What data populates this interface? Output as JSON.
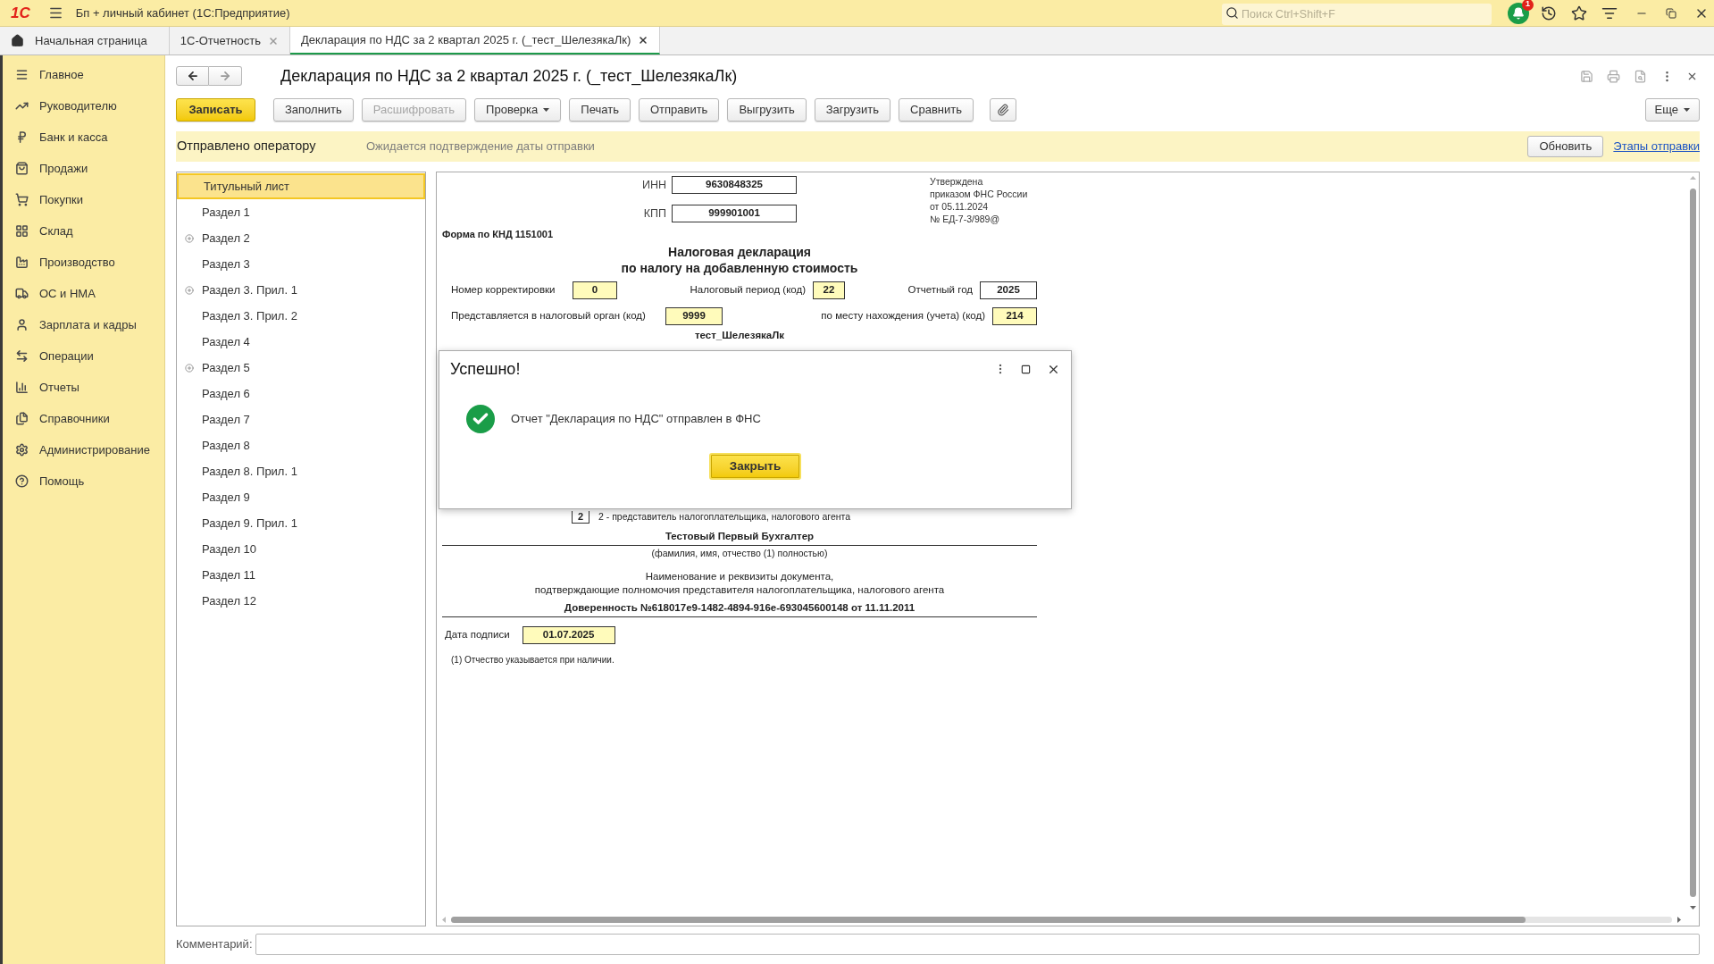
{
  "app": {
    "logo": "1С",
    "title": "Бп + личный кабинет  (1С:Предприятие)",
    "search": {
      "placeholder": "Поиск Ctrl+Shift+F"
    },
    "notifications": "1"
  },
  "tabs": [
    {
      "label": "Начальная страница",
      "kind": "home",
      "selected": false
    },
    {
      "label": "1С-Отчетность",
      "kind": "closable",
      "selected": false
    },
    {
      "label": "Декларация по НДС за 2 квартал 2025 г. (_тест_ШелезякаЛк)",
      "kind": "closable",
      "selected": true
    }
  ],
  "sidebar": {
    "items": [
      {
        "label": "Главное"
      },
      {
        "label": "Руководителю"
      },
      {
        "label": "Банк и касса"
      },
      {
        "label": "Продажи"
      },
      {
        "label": "Покупки"
      },
      {
        "label": "Склад"
      },
      {
        "label": "Производство"
      },
      {
        "label": "ОС и НМА"
      },
      {
        "label": "Зарплата и кадры"
      },
      {
        "label": "Операции"
      },
      {
        "label": "Отчеты"
      },
      {
        "label": "Справочники"
      },
      {
        "label": "Администрирование"
      },
      {
        "label": "Помощь"
      }
    ]
  },
  "form": {
    "title": "Декларация по НДС за 2 квартал 2025 г. (_тест_ШелезякаЛк)",
    "toolbar": [
      {
        "label": "Записать",
        "kind": "primary",
        "disabled": false
      },
      {
        "label": "Заполнить",
        "kind": "plain",
        "disabled": false
      },
      {
        "label": "Расшифровать",
        "kind": "plain",
        "disabled": true
      },
      {
        "label": "Проверка",
        "kind": "dropdown",
        "disabled": false
      },
      {
        "label": "Печать",
        "kind": "plain",
        "disabled": false
      },
      {
        "label": "Отправить",
        "kind": "plain",
        "disabled": false
      },
      {
        "label": "Выгрузить",
        "kind": "plain",
        "disabled": false
      },
      {
        "label": "Загрузить",
        "kind": "plain",
        "disabled": false
      },
      {
        "label": "Сравнить",
        "kind": "plain",
        "disabled": false
      }
    ],
    "more": "Еще",
    "status": {
      "state": "Отправлено оператору",
      "note": "Ожидается подтверждение даты отправки",
      "refresh": "Обновить",
      "link": "Этапы отправки"
    },
    "sections": [
      {
        "label": "Титульный лист",
        "expandable": false,
        "selected": true
      },
      {
        "label": "Раздел 1",
        "expandable": false,
        "selected": false
      },
      {
        "label": "Раздел 2",
        "expandable": true,
        "selected": false
      },
      {
        "label": "Раздел 3",
        "expandable": false,
        "selected": false
      },
      {
        "label": "Раздел 3. Прил. 1",
        "expandable": true,
        "selected": false
      },
      {
        "label": "Раздел 3. Прил. 2",
        "expandable": false,
        "selected": false
      },
      {
        "label": "Раздел 4",
        "expandable": false,
        "selected": false
      },
      {
        "label": "Раздел 5",
        "expandable": true,
        "selected": false
      },
      {
        "label": "Раздел 6",
        "expandable": false,
        "selected": false
      },
      {
        "label": "Раздел 7",
        "expandable": false,
        "selected": false
      },
      {
        "label": "Раздел 8",
        "expandable": false,
        "selected": false
      },
      {
        "label": "Раздел 8. Прил. 1",
        "expandable": false,
        "selected": false
      },
      {
        "label": "Раздел 9",
        "expandable": false,
        "selected": false
      },
      {
        "label": "Раздел 9. Прил. 1",
        "expandable": false,
        "selected": false
      },
      {
        "label": "Раздел 10",
        "expandable": false,
        "selected": false
      },
      {
        "label": "Раздел 11",
        "expandable": false,
        "selected": false
      },
      {
        "label": "Раздел 12",
        "expandable": false,
        "selected": false
      }
    ],
    "document": {
      "inn": {
        "label": "ИНН",
        "value": "9630848325",
        "editable": false
      },
      "kpp": {
        "label": "КПП",
        "value": "999901001",
        "editable": false
      },
      "knd": "Форма по КНД 1151001",
      "approval": [
        "Утверждена",
        "приказом ФНС России",
        "от 05.11.2024",
        "№ ЕД-7-3/989@"
      ],
      "heading": [
        "Налоговая декларация",
        "по налогу на добавленную стоимость"
      ],
      "row1": [
        {
          "label": "Номер корректировки",
          "value": "0",
          "editable": true
        },
        {
          "label": "Налоговый период (код)",
          "value": "22",
          "editable": true
        },
        {
          "label": "Отчетный год",
          "value": "2025",
          "editable": false
        }
      ],
      "row2": [
        {
          "label": "Представляется в налоговый орган (код)",
          "value": "9999",
          "editable": true
        },
        {
          "label": "по месту нахождения (учета) (код)",
          "value": "214",
          "editable": true
        }
      ],
      "taxpayer": "тест_ШелезякаЛк",
      "signer_code": "2",
      "signer_note": "2 - представитель налогоплательщика, налогового агента",
      "signer_name": "Тестовый Первый Бухгалтер",
      "signer_caption": "(фамилия, имя, отчество (1)  полностью)",
      "doc_caption": [
        "Наименование и реквизиты документа,",
        "подтверждающие полномочия представителя налогоплательщика, налогового агента"
      ],
      "doc_value": "Доверенность №618017e9-1482-4894-916e-693045600148 от 11.11.2011",
      "sign_date": {
        "label": "Дата подписи",
        "value": "01.07.2025",
        "editable": true
      },
      "footnote": "(1) Отчество указывается при наличии."
    },
    "comment": {
      "label": "Комментарий:"
    }
  },
  "dialog": {
    "title": "Успешно!",
    "message": "Отчет \"Декларация по НДС\" отправлен в ФНС",
    "button": "Закрыть"
  }
}
